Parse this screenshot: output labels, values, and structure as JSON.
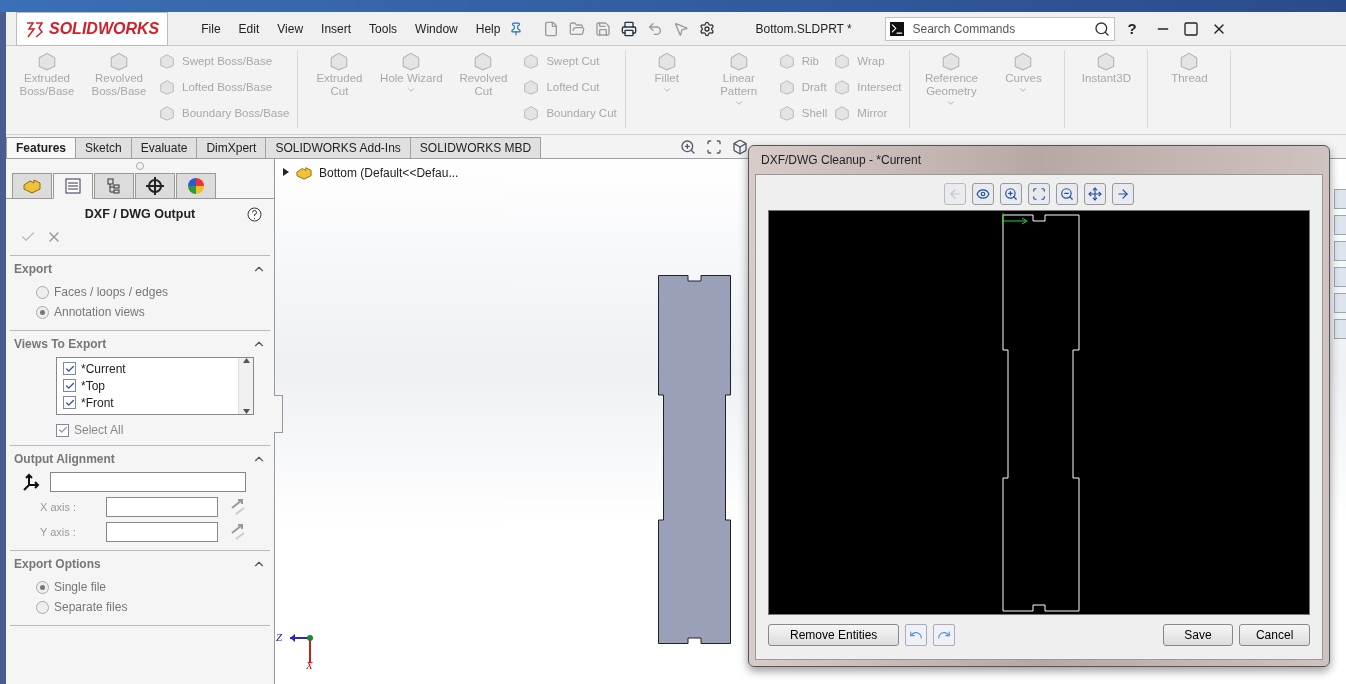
{
  "app": {
    "logo": "SOLIDWORKS",
    "menu": [
      "File",
      "Edit",
      "View",
      "Insert",
      "Tools",
      "Window",
      "Help"
    ],
    "document_title": "Bottom.SLDPRT *",
    "search": {
      "placeholder": "Search Commands"
    },
    "help": "?"
  },
  "ribbon": {
    "groups": [
      {
        "items": [
          {
            "kind": "large",
            "label": "Extruded Boss/Base"
          },
          {
            "kind": "large",
            "label": "Revolved Boss/Base"
          },
          {
            "kind": "stack",
            "labels": [
              "Swept Boss/Base",
              "Lofted Boss/Base",
              "Boundary Boss/Base"
            ]
          }
        ]
      },
      {
        "items": [
          {
            "kind": "large",
            "label": "Extruded Cut"
          },
          {
            "kind": "large",
            "label": "Hole Wizard",
            "dropdown": true
          },
          {
            "kind": "large",
            "label": "Revolved Cut"
          },
          {
            "kind": "stack",
            "labels": [
              "Swept Cut",
              "Lofted Cut",
              "Boundary Cut"
            ]
          }
        ]
      },
      {
        "items": [
          {
            "kind": "large",
            "label": "Fillet",
            "dropdown": true
          },
          {
            "kind": "large",
            "label": "Linear Pattern",
            "dropdown": true
          },
          {
            "kind": "stack",
            "labels": [
              "Rib",
              "Draft",
              "Shell"
            ]
          },
          {
            "kind": "stack",
            "labels": [
              "Wrap",
              "Intersect",
              "Mirror"
            ]
          }
        ]
      },
      {
        "items": [
          {
            "kind": "large",
            "label": "Reference Geometry",
            "dropdown": true
          },
          {
            "kind": "large",
            "label": "Curves",
            "dropdown": true
          }
        ]
      },
      {
        "items": [
          {
            "kind": "large",
            "label": "Instant3D"
          }
        ]
      },
      {
        "items": [
          {
            "kind": "large",
            "label": "Thread"
          }
        ]
      }
    ]
  },
  "command_tabs": [
    {
      "label": "Features",
      "selected": true
    },
    {
      "label": "Sketch",
      "selected": false
    },
    {
      "label": "Evaluate",
      "selected": false
    },
    {
      "label": "DimXpert",
      "selected": false
    },
    {
      "label": "SOLIDWORKS Add-Ins",
      "selected": false
    },
    {
      "label": "SOLIDWORKS MBD",
      "selected": false
    }
  ],
  "property_manager": {
    "tabs": [
      {
        "selected": false
      },
      {
        "selected": true
      },
      {
        "selected": false
      },
      {
        "selected": false
      },
      {
        "selected": false
      }
    ],
    "title": "DXF / DWG Output",
    "sections": [
      {
        "kind": "radios",
        "title": "Export",
        "options": [
          {
            "label": "Faces / loops / edges",
            "selected": false
          },
          {
            "label": "Annotation views",
            "selected": true
          }
        ]
      },
      {
        "kind": "views",
        "title": "Views To Export",
        "items": [
          {
            "label": "*Current",
            "checked": true
          },
          {
            "label": "*Top",
            "checked": true
          },
          {
            "label": "*Front",
            "checked": true
          }
        ],
        "select_all": {
          "label": "Select All",
          "checked": true
        }
      },
      {
        "kind": "alignment",
        "title": "Output Alignment",
        "fields": [
          {
            "label": "X axis :"
          },
          {
            "label": "Y axis :"
          }
        ]
      },
      {
        "kind": "radios",
        "title": "Export Options",
        "options": [
          {
            "label": "Single file",
            "selected": true
          },
          {
            "label": "Separate files",
            "selected": false
          }
        ]
      }
    ]
  },
  "viewport": {
    "tree_node": "Bottom  (Default<<Defau...",
    "triad": {
      "z": "Z",
      "x": "X"
    }
  },
  "dialog": {
    "title": "DXF/DWG Cleanup - *Current",
    "toolbar": [
      {
        "disabled": true
      },
      {
        "disabled": false
      },
      {
        "disabled": false
      },
      {
        "disabled": false
      },
      {
        "disabled": false
      },
      {
        "disabled": false
      },
      {
        "disabled": false
      }
    ],
    "buttons": {
      "remove": "Remove Entities",
      "save": "Save",
      "cancel": "Cancel"
    }
  }
}
